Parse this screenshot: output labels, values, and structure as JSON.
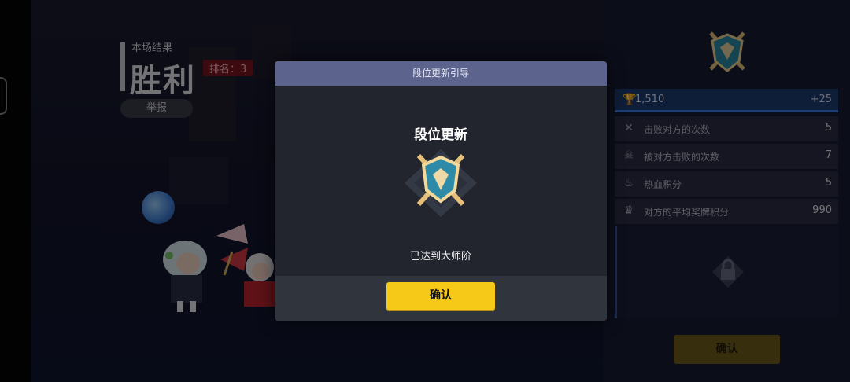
{
  "result": {
    "subtitle": "本场结果",
    "outcome": "胜利",
    "rank_label": "排名：3",
    "report_button": "举报"
  },
  "sidebar": {
    "trophies": {
      "value": "1,510",
      "gain": "+25",
      "icon": "trophy-icon"
    },
    "stats": [
      {
        "icon": "crossed-swords-icon",
        "label": "击败对方的次数",
        "value": "5"
      },
      {
        "icon": "skull-icon",
        "label": "被对方击败的次数",
        "value": "7"
      },
      {
        "icon": "flame-icon",
        "label": "热血积分",
        "value": "5"
      },
      {
        "icon": "trophy-cup-icon",
        "label": "对方的平均奖牌积分",
        "value": "990"
      }
    ],
    "confirm_button": "确认"
  },
  "modal": {
    "header": "段位更新引导",
    "title": "段位更新",
    "message": "已达到大师阶",
    "confirm_button": "确认"
  },
  "colors": {
    "accent_yellow": "#f6c817",
    "modal_header": "#5c638c",
    "trophy_bar": "#1c3a70",
    "rank_badge": "#7a1420"
  }
}
